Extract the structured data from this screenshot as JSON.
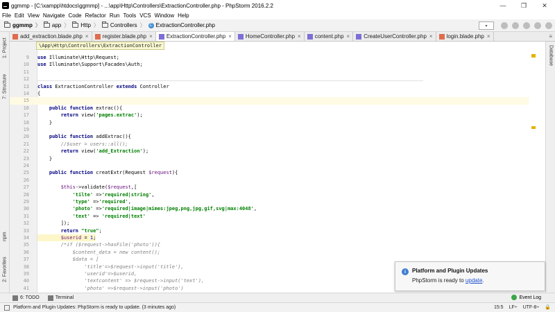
{
  "window": {
    "title": "ggmmp - [C:\\xampp\\htdocs\\ggmmp] - ...\\app\\Http\\Controllers\\ExtractionController.php - PhpStorm 2016.2.2",
    "minimize": "—",
    "maximize": "❐",
    "close": "✕"
  },
  "menu": [
    "File",
    "Edit",
    "View",
    "Navigate",
    "Code",
    "Refactor",
    "Run",
    "Tools",
    "VCS",
    "Window",
    "Help"
  ],
  "breadcrumbs": [
    "ggmmp",
    "app",
    "Http",
    "Controllers",
    "ExtractionController.php"
  ],
  "tabs": [
    {
      "label": "add_extraction.blade.php",
      "type": "blade",
      "active": false
    },
    {
      "label": "register.blade.php",
      "type": "blade",
      "active": false
    },
    {
      "label": "ExtractionController.php",
      "type": "php",
      "active": true
    },
    {
      "label": "HomeController.php",
      "type": "php",
      "active": false
    },
    {
      "label": "content.php",
      "type": "php",
      "active": false
    },
    {
      "label": "CreateUserController.php",
      "type": "php",
      "active": false
    },
    {
      "label": "login.blade.php",
      "type": "blade",
      "active": false
    }
  ],
  "tab_close_glyph": "×",
  "tab_more_glyph": "≡",
  "left_tools": {
    "project": "1: Project",
    "structure": "7: Structure",
    "npm": "npm",
    "favorites": "2: Favorites"
  },
  "right_tools": {
    "database": "Database"
  },
  "editor": {
    "namespace_tooltip": "\\App\\Http\\Controllers\\ExtractionController",
    "lines": [
      {
        "n": "9",
        "code": "use Illuminate\\Http\\Request;"
      },
      {
        "n": "10",
        "code": "use Illuminate\\Support\\Facades\\Auth;"
      },
      {
        "n": "11",
        "code": ""
      },
      {
        "n": "12",
        "code": ""
      },
      {
        "n": "13",
        "code": "class ExtractionController extends Controller"
      },
      {
        "n": "14",
        "code": "{"
      },
      {
        "n": "15",
        "code": ""
      },
      {
        "n": "16",
        "code": "    public function extrac(){"
      },
      {
        "n": "17",
        "code": "        return view('pages.extrac');"
      },
      {
        "n": "18",
        "code": "    }"
      },
      {
        "n": "19",
        "code": ""
      },
      {
        "n": "20",
        "code": "    public function addExtrac(){"
      },
      {
        "n": "21",
        "code": "        //$user = users::all();"
      },
      {
        "n": "22",
        "code": "        return view('add_Extraction');"
      },
      {
        "n": "23",
        "code": "    }"
      },
      {
        "n": "24",
        "code": ""
      },
      {
        "n": "25",
        "code": "    public function creatExtr(Request $request){"
      },
      {
        "n": "26",
        "code": ""
      },
      {
        "n": "27",
        "code": "        $this->validate($request,["
      },
      {
        "n": "28",
        "code": "            'tilte' =>'required|string',"
      },
      {
        "n": "29",
        "code": "            'type' =>'required',"
      },
      {
        "n": "30",
        "code": "            'photo' =>'required|image|mimes:jpeg,png,jpg,gif,svg|max:4048',"
      },
      {
        "n": "31",
        "code": "            'text' => 'required|text'"
      },
      {
        "n": "32",
        "code": "        ]);"
      },
      {
        "n": "33",
        "code": "        return \"true\";"
      },
      {
        "n": "34",
        "code": "        $userid = 1;"
      },
      {
        "n": "35",
        "code": "        /*if ($request->hasFile('photo')){"
      },
      {
        "n": "36",
        "code": "            $content_data = new content();"
      },
      {
        "n": "37",
        "code": "            $data = ["
      },
      {
        "n": "38",
        "code": "                'title'=>$request->input('title'),"
      },
      {
        "n": "39",
        "code": "                'userid'=>$userid,"
      },
      {
        "n": "40",
        "code": "                'textcontent' => $request->input('text'),"
      },
      {
        "n": "41",
        "code": "                'photo' =>$request->input('photo')"
      }
    ]
  },
  "notification": {
    "title": "Platform and Plugin Updates",
    "body_prefix": "PhpStorm is ready to ",
    "link": "update",
    "body_suffix": "."
  },
  "bottom_tools": {
    "todo": "6: TODO",
    "terminal": "Terminal",
    "event_log": "Event Log"
  },
  "status": {
    "message": "Platform and Plugin Updates: PhpStorm is ready to update. (3 minutes ago)",
    "position": "15:5",
    "line_sep": "LF÷",
    "encoding": "UTF-8÷"
  },
  "colors": {
    "keyword": "#000080",
    "string": "#008000",
    "variable": "#660e7a",
    "comment": "#808080",
    "accent": "#3e7ed0"
  }
}
